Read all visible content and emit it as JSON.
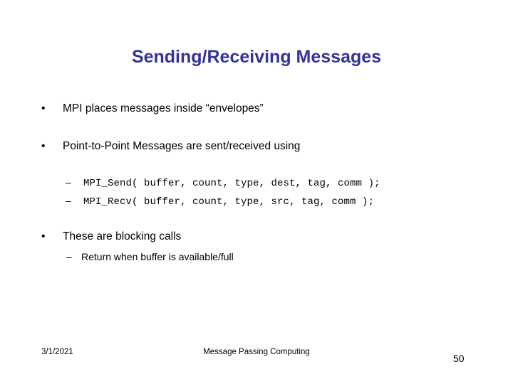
{
  "slide": {
    "title": "Sending/Receiving Messages",
    "title_color": "#333399",
    "background_color": "#ffffff",
    "bullet_marker": "•",
    "dash_marker": "–",
    "content": [
      {
        "level": 1,
        "marker": "•",
        "text": "MPI places messages inside “envelopes”"
      },
      {
        "level": 1,
        "marker": "•",
        "text": "Point-to-Point Messages are sent/received using"
      },
      {
        "level": 2,
        "marker": "–",
        "style": "code",
        "text": "MPI_Send( buffer, count, type, dest, tag, comm );"
      },
      {
        "level": 2,
        "marker": "–",
        "style": "code",
        "text": "MPI_Recv( buffer, count, type, src, tag, comm );"
      },
      {
        "level": 1,
        "marker": "•",
        "text": "These are blocking calls"
      },
      {
        "level": 2,
        "marker": "–",
        "style": "plain",
        "text": "Return when buffer is available/full"
      }
    ]
  },
  "footer": {
    "date": "3/1/2021",
    "center_text": "Message Passing Computing",
    "page_number": "50"
  }
}
